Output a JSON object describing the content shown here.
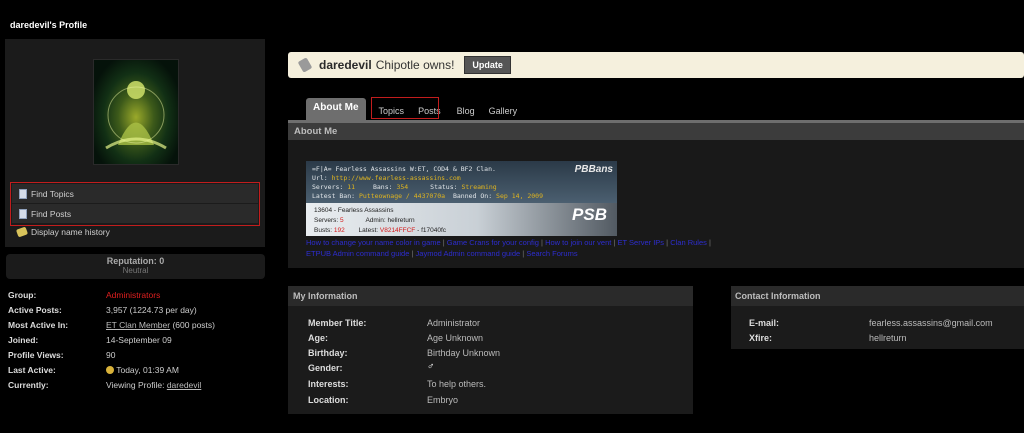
{
  "profile_title": "daredevil's Profile",
  "left": {
    "links": [
      {
        "label": "Find Topics",
        "icon": "document-icon"
      },
      {
        "label": "Find Posts",
        "icon": "document-icon"
      }
    ],
    "display_history": "Display name history",
    "reputation_title": "Reputation: 0",
    "reputation_level": "Neutral"
  },
  "info": [
    {
      "label": "Group:",
      "value": "Administrators",
      "color": "#e01f1f"
    },
    {
      "label": "Active Posts:",
      "value": "3,957 (1224.73 per day)"
    },
    {
      "label": "Most Active In:",
      "value": "ET Clan Member",
      "extra": "(600 posts)"
    },
    {
      "label": "Joined:",
      "value": "14-September 09"
    },
    {
      "label": "Profile Views:",
      "value": "90"
    },
    {
      "label": "Last Active:",
      "value": "Today, 01:39 AM"
    },
    {
      "label": "Currently:",
      "value": "Viewing Profile:",
      "extra": "daredevil"
    }
  ],
  "status": {
    "name": "daredevil",
    "message": "Chipotle owns!",
    "update_button": "Update"
  },
  "tabs": [
    {
      "label": "About Me",
      "active": true
    },
    {
      "label": "Topics"
    },
    {
      "label": "Posts"
    },
    {
      "label": "Blog"
    },
    {
      "label": "Gallery"
    }
  ],
  "about_header": "About Me",
  "signature": {
    "line1": "=F|A=   Fearless Assassins   W:ET, COD4 & BF2 Clan.",
    "url_label": "Url:",
    "url": "http://www.fearless-assassins.com",
    "servers_label": "Servers:",
    "servers": "11",
    "bans_label": "Bans:",
    "bans": "354",
    "status_label": "Status:",
    "status": "Streaming",
    "latest_ban_label": "Latest Ban:",
    "latest_ban": "Putteownage / 4437070a",
    "banned_on_label": "Banned On:",
    "banned_on": "Sep 14, 2009",
    "pbb": "PBBans",
    "block_title": "13604 - Fearless Assassins",
    "b_servers_label": "Servers:",
    "b_servers": "5",
    "admin": "Admin: hellreturn",
    "busts_label": "Busts:",
    "busts": "192",
    "latest_label": "Latest:",
    "latest_red": "V8214FFCF",
    "latest_rest": "- f17040fc",
    "psb": "PSB"
  },
  "sig_links": [
    "How to change your name color in game",
    "Game Crans for your config",
    "How to join our vent",
    "ET Server IPs",
    "Clan Rules",
    "ETPUB Admin command guide",
    "Jaymod Admin command guide",
    "Search Forums"
  ],
  "my_info": {
    "header": "My Information",
    "rows": [
      {
        "label": "Member Title:",
        "value": "Administrator"
      },
      {
        "label": "Age:",
        "value": "Age Unknown"
      },
      {
        "label": "Birthday:",
        "value": "Birthday Unknown"
      },
      {
        "label": "Gender:",
        "value": "♂"
      },
      {
        "label": "Interests:",
        "value": "To help others."
      },
      {
        "label": "Location:",
        "value": "Embryo"
      }
    ]
  },
  "contact": {
    "header": "Contact Information",
    "rows": [
      {
        "label": "E-mail:",
        "value": "fearless.assassins@gmail.com"
      },
      {
        "label": "Xfire:",
        "value": "hellreturn"
      }
    ]
  }
}
